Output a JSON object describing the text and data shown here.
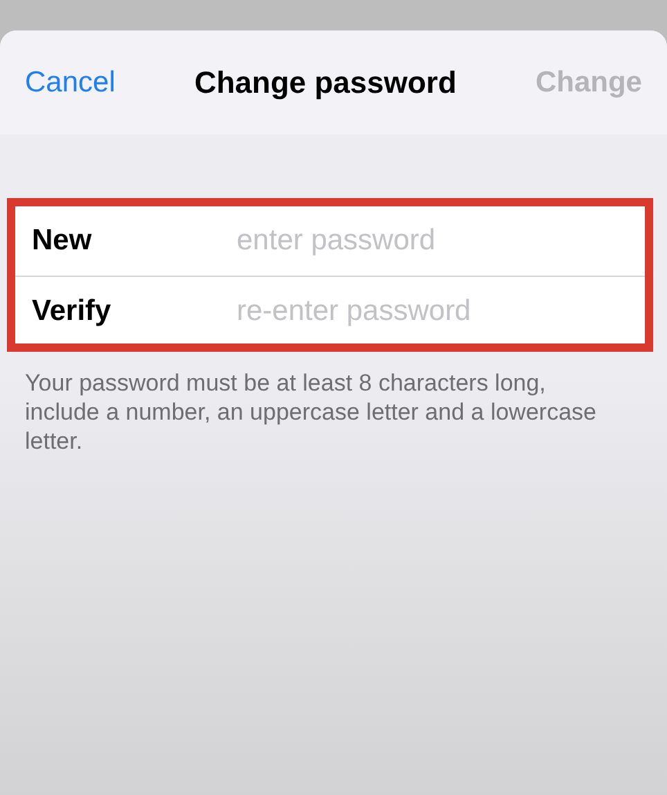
{
  "sheet": {
    "cancel": "Cancel",
    "title": "Change password",
    "change": {
      "label": "Change",
      "disabled": true
    }
  },
  "form": {
    "highlighted": true,
    "fields": [
      {
        "label": "New",
        "placeholder": "enter password"
      },
      {
        "label": "Verify",
        "placeholder": "re-enter password"
      }
    ]
  },
  "hint": "Your password must be at least 8 characters long, include a number, an uppercase letter and a lowercase letter."
}
